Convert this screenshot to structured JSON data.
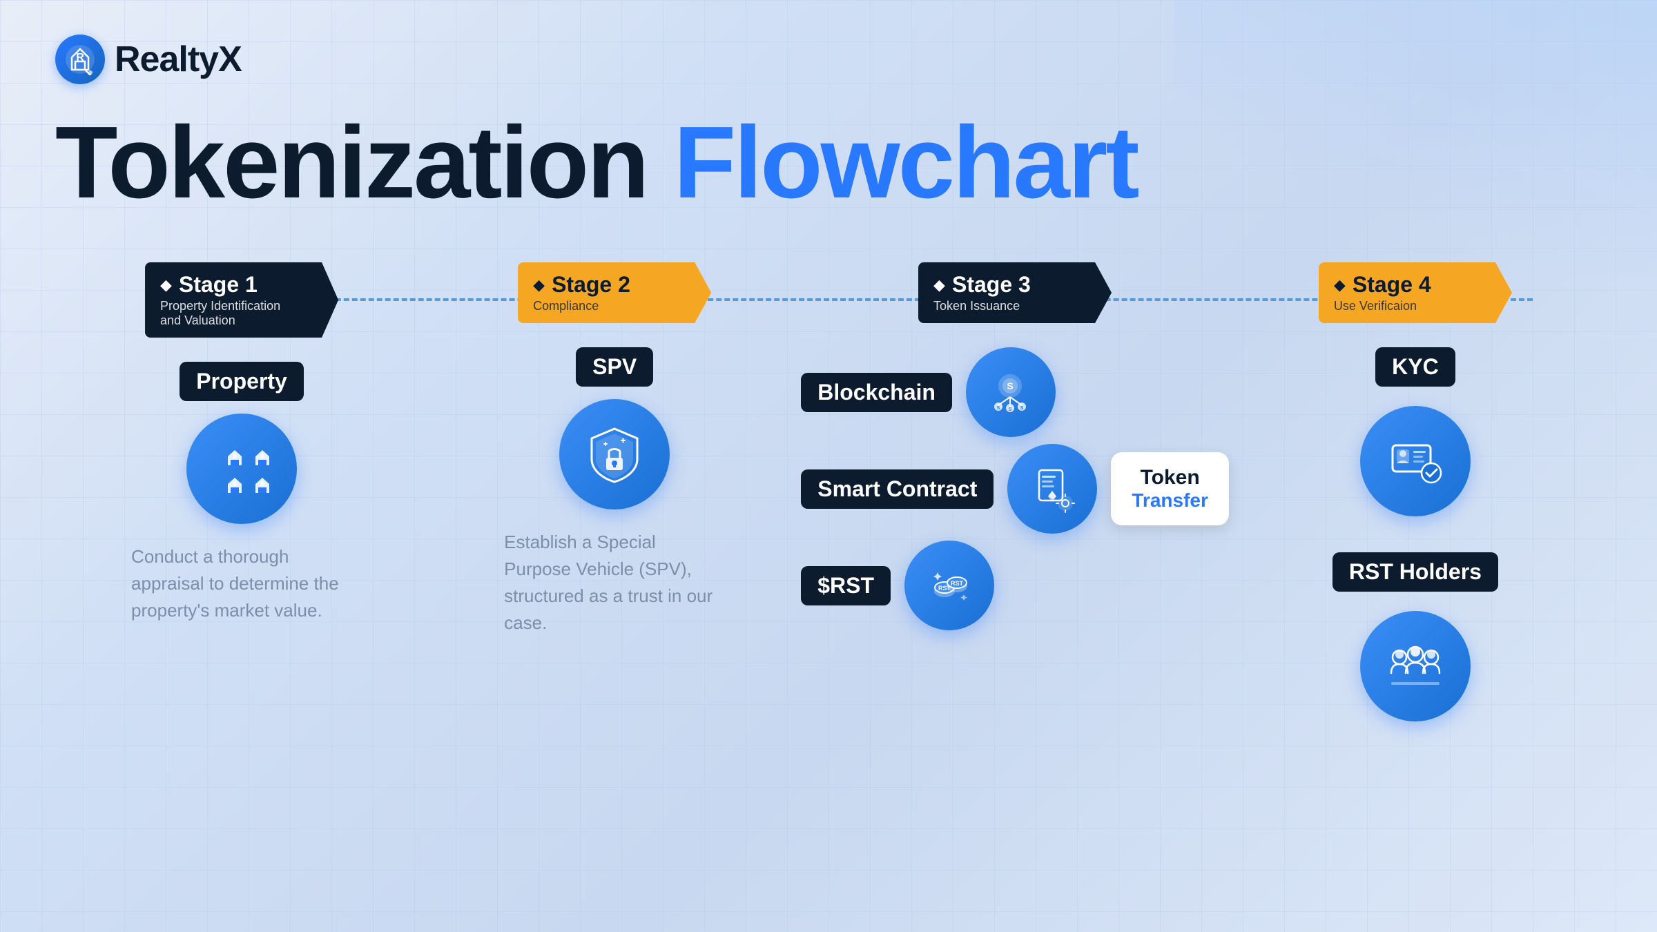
{
  "logo": {
    "text": "RealtyX"
  },
  "title": {
    "part1": "Tokenization ",
    "part2": "Flowchart"
  },
  "stages": [
    {
      "id": "stage1",
      "badge_color": "dark",
      "number": "Stage 1",
      "subtitle": "Property Identification\nand Valuation",
      "node_label": "Property",
      "description": "Conduct a thorough appraisal to determine the property's market value."
    },
    {
      "id": "stage2",
      "badge_color": "gold",
      "number": "Stage 2",
      "subtitle": "Compliance",
      "node_label": "SPV",
      "description": "Establish a Special Purpose Vehicle (SPV), structured as a trust in our case."
    },
    {
      "id": "stage3",
      "badge_color": "dark",
      "number": "Stage 3",
      "subtitle": "Token Issuance",
      "items": [
        {
          "label": "Blockchain"
        },
        {
          "label": "Smart Contract"
        },
        {
          "label": "$RST"
        }
      ],
      "token_transfer": {
        "line1": "Token",
        "line2": "Transfer"
      }
    },
    {
      "id": "stage4",
      "badge_color": "gold",
      "number": "Stage 4",
      "subtitle": "Use Verificaion",
      "items": [
        {
          "label": "KYC"
        },
        {
          "label": "RST Holders"
        }
      ]
    }
  ]
}
